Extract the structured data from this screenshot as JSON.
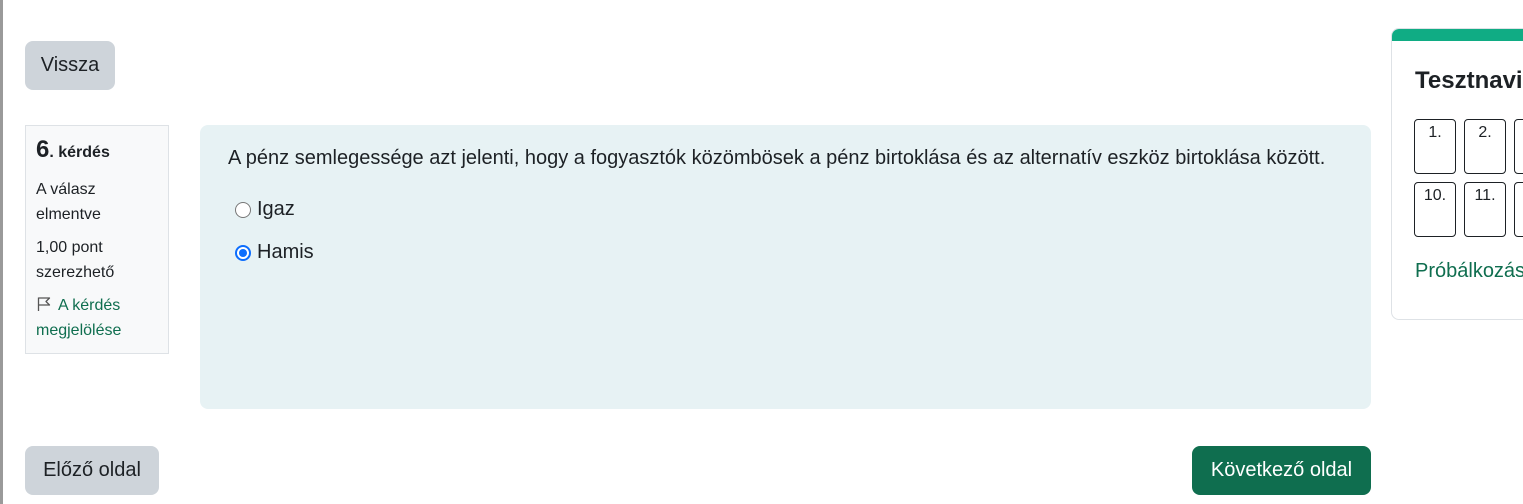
{
  "buttons": {
    "back": "Vissza",
    "prev": "Előző oldal",
    "next": "Következő oldal"
  },
  "question_info": {
    "number": "6",
    "label": ". kérdés",
    "state": "A válasz elmentve",
    "grade": "1,00 pont szerezhető",
    "flag": "A kérdés megjelölése"
  },
  "question": {
    "text": "A pénz semlegessége azt jelenti, hogy a fogyasztók közömbösek a pénz birtoklása és az alternatív eszköz birtoklása között.",
    "answers": [
      {
        "label": "Igaz",
        "selected": false
      },
      {
        "label": "Hamis",
        "selected": true
      }
    ]
  },
  "navigation": {
    "title": "Tesztnavi",
    "buttons": [
      "1.",
      "2.",
      "",
      "10.",
      "11.",
      ""
    ],
    "attempt_link": "Próbálkozás"
  },
  "colors": {
    "primary": "#0f6e4f",
    "accent": "#10ac84",
    "question_bg": "#e7f2f4",
    "radio_selected": "#0d6efd"
  }
}
